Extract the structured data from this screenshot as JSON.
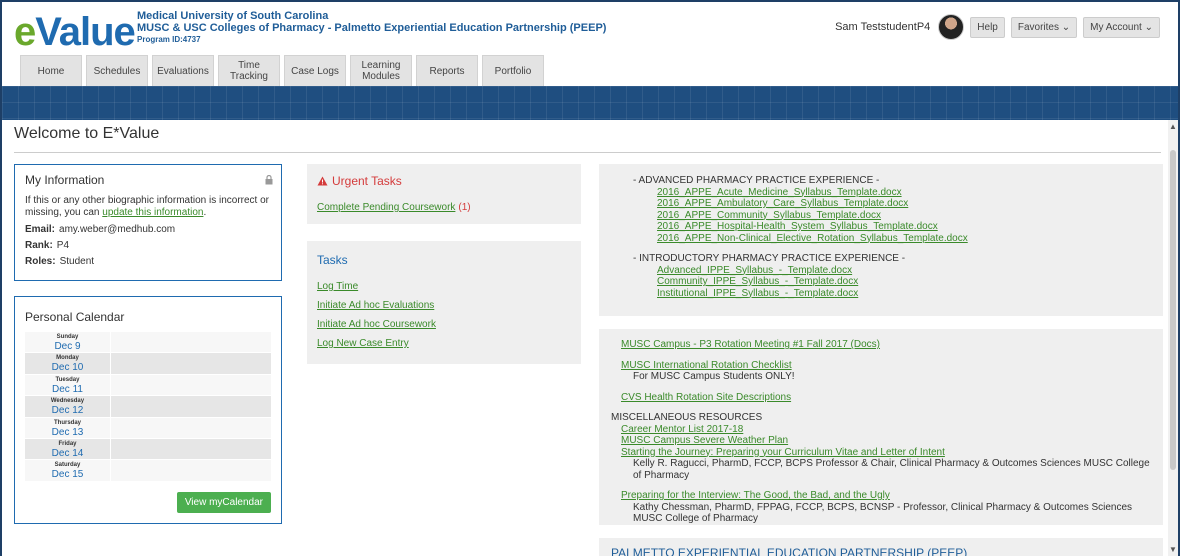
{
  "header": {
    "logo_e": "e",
    "logo_value": "Value",
    "institution_line1": "Medical University of South Carolina",
    "institution_line2": "MUSC & USC Colleges of Pharmacy - Palmetto Experiential Education Partnership (PEEP)",
    "program_id": "Program ID:4737",
    "user_name": "Sam TeststudentP4",
    "help_label": "Help",
    "favorites_label": "Favorites ⌄",
    "account_label": "My Account ⌄"
  },
  "tabs": [
    {
      "label": "Home"
    },
    {
      "label": "Schedules"
    },
    {
      "label": "Evaluations"
    },
    {
      "label": "Time Tracking"
    },
    {
      "label": "Case Logs"
    },
    {
      "label": "Learning Modules"
    },
    {
      "label": "Reports"
    },
    {
      "label": "Portfolio"
    }
  ],
  "page": {
    "title": "Welcome to E*Value"
  },
  "my_info": {
    "title": "My Information",
    "text_before": "If this or any other biographic information is incorrect or missing, you can ",
    "link": "update this information",
    "text_after": ".",
    "email_label": "Email:",
    "email": "amy.weber@medhub.com",
    "rank_label": "Rank:",
    "rank": "P4",
    "roles_label": "Roles:",
    "roles": "Student"
  },
  "calendar": {
    "title": "Personal Calendar",
    "days": [
      {
        "dow": "Sunday",
        "date": "Dec 9"
      },
      {
        "dow": "Monday",
        "date": "Dec 10"
      },
      {
        "dow": "Tuesday",
        "date": "Dec 11"
      },
      {
        "dow": "Wednesday",
        "date": "Dec 12"
      },
      {
        "dow": "Thursday",
        "date": "Dec 13"
      },
      {
        "dow": "Friday",
        "date": "Dec 14"
      },
      {
        "dow": "Saturday",
        "date": "Dec 15"
      }
    ],
    "button": "View myCalendar"
  },
  "urgent": {
    "title": "Urgent Tasks",
    "link": "Complete Pending Coursework",
    "count": "(1)"
  },
  "tasks": {
    "title": "Tasks",
    "links": [
      "Log Time",
      "Initiate Ad hoc Evaluations",
      "Initiate Ad hoc Coursework",
      "Log New Case Entry"
    ]
  },
  "syllabi": {
    "appe_head": "- ADVANCED PHARMACY PRACTICE EXPERIENCE -",
    "appe_docs": [
      "2016_APPE_Acute_Medicine_Syllabus_Template.docx",
      "2016_APPE_Ambulatory_Care_Syllabus_Template.docx",
      "2016_APPE_Community_Syllabus_Template.docx",
      "2016_APPE_Hospital-Health_System_Syllabus_Template.docx",
      "2016_APPE_Non-Clinical_Elective_Rotation_Syllabus_Template.docx"
    ],
    "ippe_head": "- INTRODUCTORY PHARMACY PRACTICE EXPERIENCE -",
    "ippe_docs": [
      "Advanced_IPPE_Syllabus_-_Template.docx",
      "Community_IPPE_Syllabus_-_Template.docx",
      "Institutional_IPPE_Syllabus_-_Template.docx"
    ]
  },
  "resources": {
    "meeting": "MUSC Campus - P3 Rotation Meeting #1 Fall 2017 (Docs)",
    "intl": "MUSC International Rotation Checklist",
    "intl_note": "For MUSC Campus Students ONLY!",
    "cvs": "CVS Health Rotation Site Descriptions",
    "misc_head": "MISCELLANEOUS RESOURCES",
    "mentor": "Career Mentor List 2017-18",
    "weather": "MUSC Campus Severe Weather Plan",
    "journey": "Starting the Journey: Preparing your Curriculum Vitae and Letter of Intent",
    "journey_note": "Kelly R. Ragucci, PharmD, FCCP, BCPS Professor & Chair, Clinical Pharmacy & Outcomes Sciences MUSC College of Pharmacy",
    "interview": "Preparing for the Interview: The Good, the Bad, and the Ugly",
    "interview_note": "Kathy Chessman, PharmD, FPPAG, FCCP, BCPS, BCNSP - Professor, Clinical Pharmacy & Outcomes Sciences MUSC College of Pharmacy"
  },
  "peep": {
    "title": "PALMETTO EXPERIENTIAL EDUCATION PARTNERSHIP (PEEP)"
  }
}
